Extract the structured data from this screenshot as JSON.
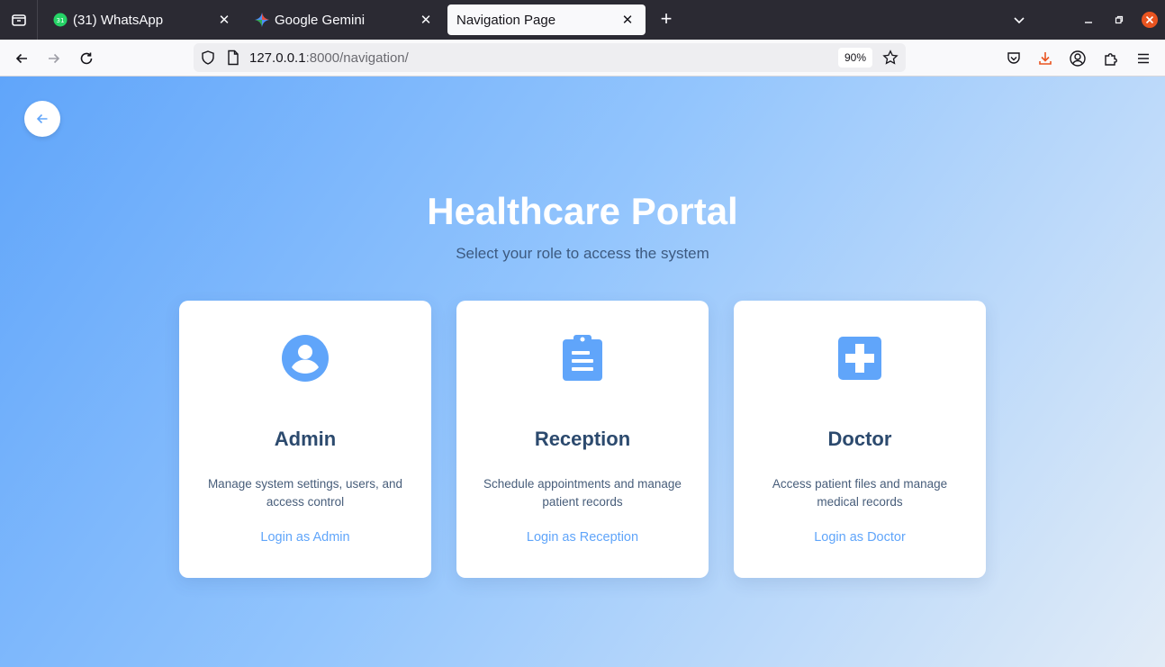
{
  "browser": {
    "tabs": [
      {
        "title": "(31) WhatsApp",
        "favicon": "whatsapp-icon",
        "badge": "31",
        "active": false
      },
      {
        "title": "Google Gemini",
        "favicon": "gemini-icon",
        "active": false
      },
      {
        "title": "Navigation Page",
        "active": true
      }
    ],
    "url_host": "127.0.0.1",
    "url_rest": ":8000/navigation/",
    "zoom": "90%"
  },
  "page": {
    "title": "Healthcare Portal",
    "subtitle": "Select your role to access the system",
    "cards": [
      {
        "icon": "user-circle-icon",
        "title": "Admin",
        "description": "Manage system settings, users, and access control",
        "link": "Login as Admin"
      },
      {
        "icon": "clipboard-icon",
        "title": "Reception",
        "description": "Schedule appointments and manage patient records",
        "link": "Login as Reception"
      },
      {
        "icon": "medical-cross-icon",
        "title": "Doctor",
        "description": "Access patient files and manage medical records",
        "link": "Login as Doctor"
      }
    ]
  },
  "colors": {
    "accent": "#60a5fa",
    "title_text": "#2c4a6e"
  }
}
